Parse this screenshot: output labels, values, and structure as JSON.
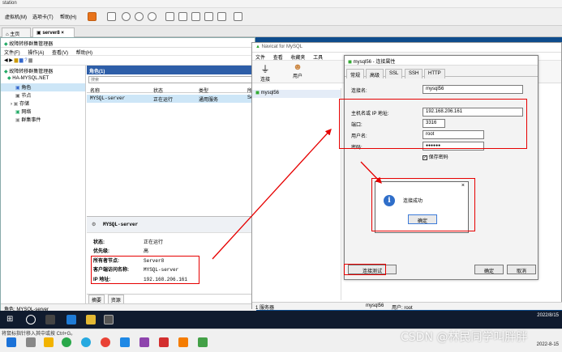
{
  "vm": {
    "title": "station",
    "menu": [
      "虚拟机(M)",
      "选项卡(T)",
      "帮助(H)"
    ],
    "tabs": [
      "主页",
      "server8"
    ]
  },
  "fcm": {
    "title": "故障转移群集管理器",
    "menu": [
      "文件(F)",
      "操作(A)",
      "查看(V)",
      "帮助(H)"
    ],
    "tree": [
      "故障转移群集管理器",
      "HA-MYSQL.NET",
      "角色",
      "节点",
      "存储",
      "网络",
      "群集事件"
    ],
    "pane_title": "角色(1)",
    "search_placeholder": "搜索",
    "columns": [
      "名称",
      "状态",
      "类型",
      "所"
    ],
    "row": {
      "name": "MYSQL-server",
      "state": "正在运行",
      "type": "通用服务",
      "owner": "Se"
    },
    "detail": {
      "title": "MYSQL-server",
      "labels": [
        "状态:",
        "优先级:",
        "所有者节点:",
        "客户端访问名称:",
        "IP 地址:"
      ],
      "values": [
        "正在运行",
        "高",
        "Server8",
        "MYSQL-server",
        "192.168.206.161"
      ]
    },
    "bottom_tabs": [
      "摘要",
      "资源"
    ],
    "status": "角色: MYSQL-server"
  },
  "navicat": {
    "title": "Navicat for MySQL",
    "menu": [
      "文件",
      "查看",
      "收藏夹",
      "工具"
    ],
    "toolbar": [
      "连接",
      "用户"
    ],
    "connection": "mysql56",
    "status_left": "1 服务器",
    "status_conn": "mysql56",
    "status_user": "用户: root"
  },
  "dialog": {
    "title": "mysql56 - 连接属性",
    "tabs": [
      "常规",
      "高级",
      "SSL",
      "SSH",
      "HTTP"
    ],
    "labels": {
      "conn_name": "连接名:",
      "host": "主机名或 IP 地址:",
      "port": "端口:",
      "user": "用户名:",
      "password": "密码:",
      "save_pw": "保存密码"
    },
    "values": {
      "conn_name": "mysql56",
      "host": "192.168.206.161",
      "port": "3316",
      "user": "root",
      "password": "●●●●●●"
    },
    "buttons": {
      "test": "连接测试",
      "ok": "确定",
      "cancel": "取消"
    }
  },
  "message": {
    "text": "连接成功",
    "ok": "确定",
    "close": "×"
  },
  "taskbar": {
    "clock_time": "2022/8/15",
    "clock_date": "2022-8-15",
    "ime_hint": "将鼠标指针移入其中或按 Ctrl+G。"
  },
  "watermark": "CSDN @林民同学叫胖胖"
}
